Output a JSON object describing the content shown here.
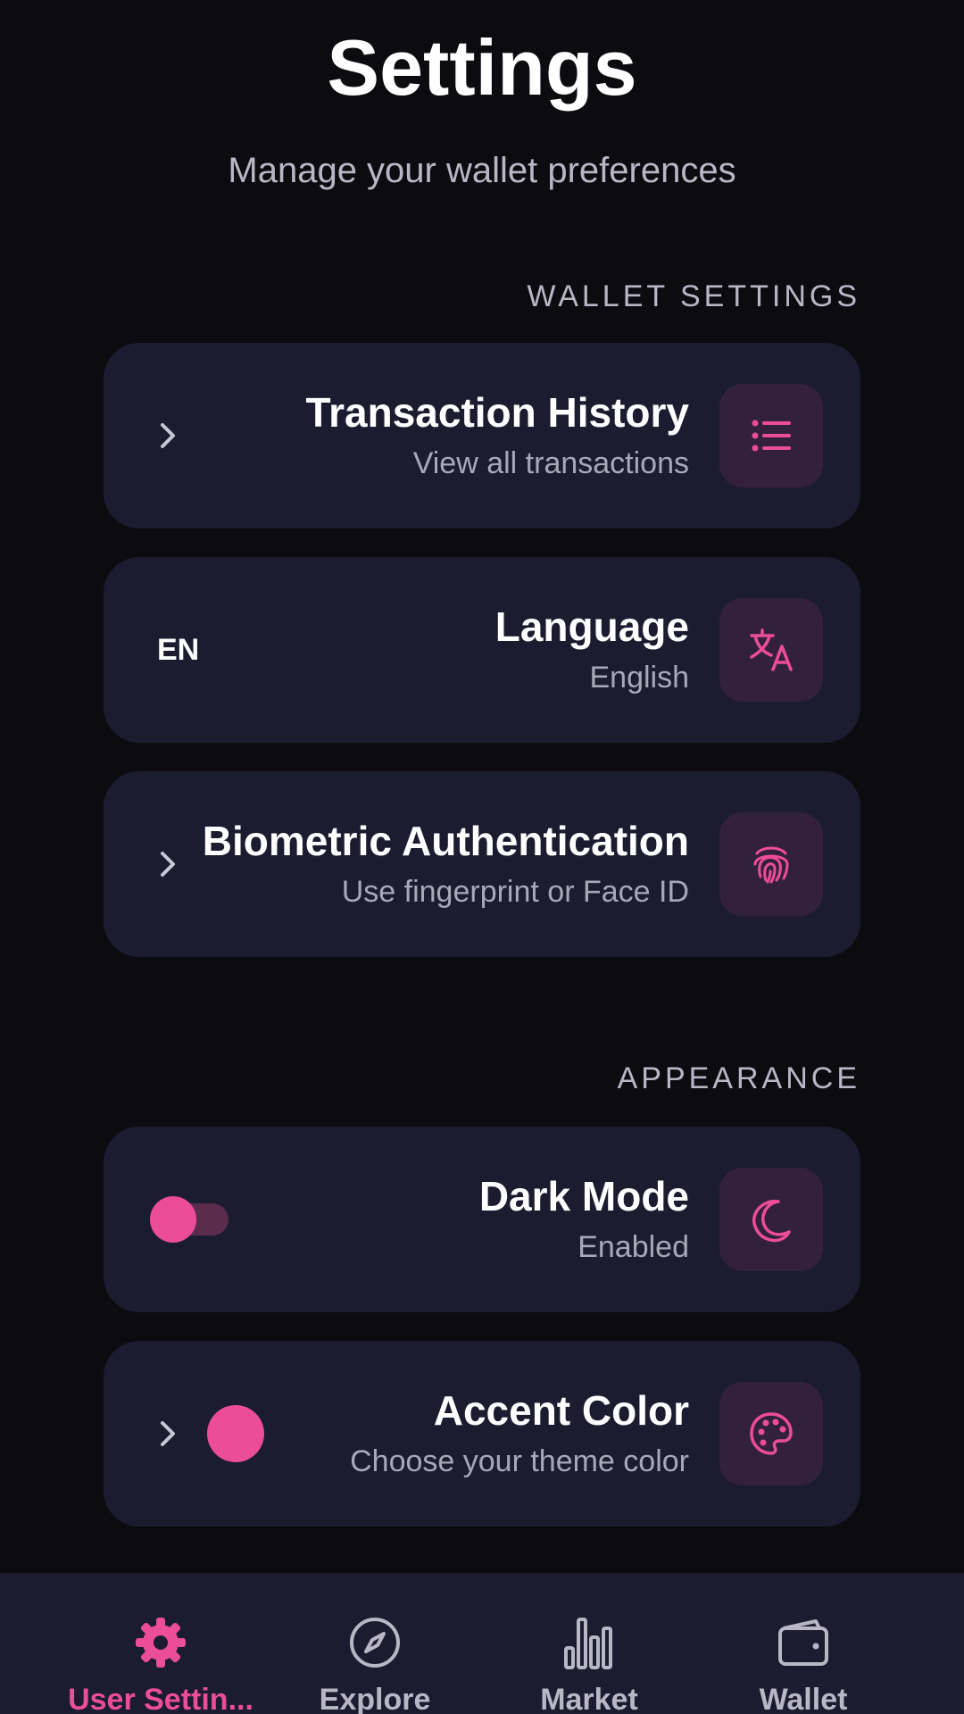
{
  "header": {
    "title": "Settings",
    "subtitle": "Manage your wallet preferences"
  },
  "sections": {
    "wallet_settings_label": "WALLET SETTINGS",
    "appearance_label": "APPEARANCE"
  },
  "wallet_items": [
    {
      "title": "Transaction History",
      "subtitle": "View all transactions",
      "icon": "list-icon"
    },
    {
      "title": "Language",
      "subtitle": "English",
      "value": "EN",
      "icon": "translate-icon"
    },
    {
      "title": "Biometric Authentication",
      "subtitle": "Use fingerprint or Face ID",
      "icon": "fingerprint-icon"
    }
  ],
  "appearance_items": [
    {
      "title": "Dark Mode",
      "subtitle": "Enabled",
      "toggle_on": true,
      "icon": "moon-icon"
    },
    {
      "title": "Accent Color",
      "subtitle": "Choose your theme color",
      "swatch_color": "#ec4d9a",
      "icon": "palette-icon"
    }
  ],
  "bottom_nav": [
    {
      "label": "User Settin...",
      "icon": "gear-icon",
      "active": true
    },
    {
      "label": "Explore",
      "icon": "compass-icon",
      "active": false
    },
    {
      "label": "Market",
      "icon": "bar-chart-icon",
      "active": false
    },
    {
      "label": "Wallet",
      "icon": "wallet-icon",
      "active": false
    }
  ],
  "colors": {
    "accent": "#ec4d9a",
    "background": "#0b0b10",
    "card": "#1b1c2f",
    "icon_box": "#33203d",
    "muted_text": "#b9b7c6"
  }
}
